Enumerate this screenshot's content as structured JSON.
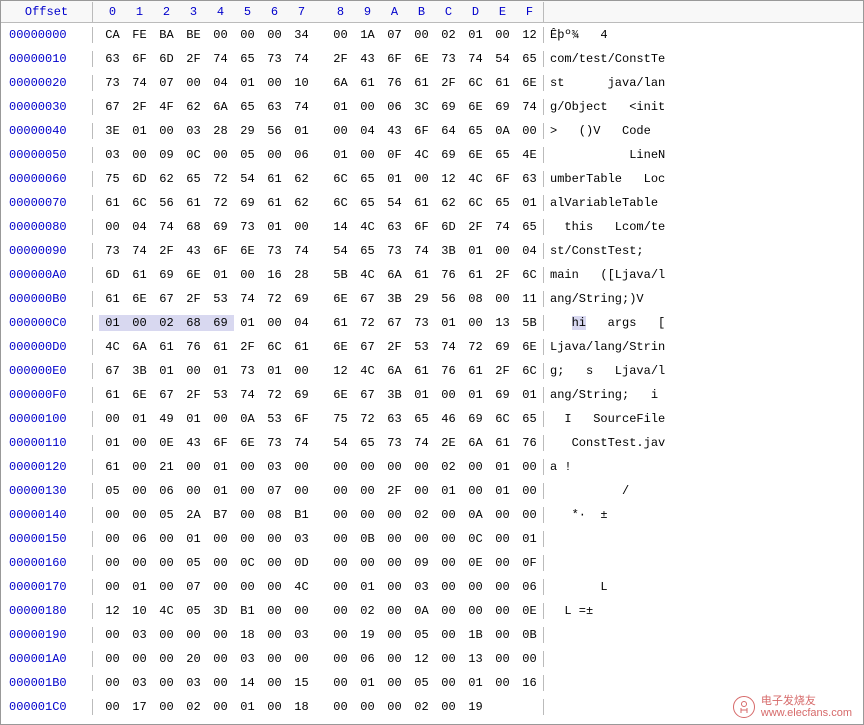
{
  "header": {
    "offset_label": "Offset",
    "columns": [
      "0",
      "1",
      "2",
      "3",
      "4",
      "5",
      "6",
      "7",
      "8",
      "9",
      "A",
      "B",
      "C",
      "D",
      "E",
      "F"
    ]
  },
  "highlight": {
    "row": 12,
    "start": 0,
    "end": 4
  },
  "ascii_highlight": {
    "row": 12,
    "text": "hi"
  },
  "rows": [
    {
      "offset": "00000000",
      "hex": [
        "CA",
        "FE",
        "BA",
        "BE",
        "00",
        "00",
        "00",
        "34",
        "00",
        "1A",
        "07",
        "00",
        "02",
        "01",
        "00",
        "12"
      ],
      "ascii": "Êþº¾   4        "
    },
    {
      "offset": "00000010",
      "hex": [
        "63",
        "6F",
        "6D",
        "2F",
        "74",
        "65",
        "73",
        "74",
        "2F",
        "43",
        "6F",
        "6E",
        "73",
        "74",
        "54",
        "65"
      ],
      "ascii": "com/test/ConstTe"
    },
    {
      "offset": "00000020",
      "hex": [
        "73",
        "74",
        "07",
        "00",
        "04",
        "01",
        "00",
        "10",
        "6A",
        "61",
        "76",
        "61",
        "2F",
        "6C",
        "61",
        "6E"
      ],
      "ascii": "st      java/lan"
    },
    {
      "offset": "00000030",
      "hex": [
        "67",
        "2F",
        "4F",
        "62",
        "6A",
        "65",
        "63",
        "74",
        "01",
        "00",
        "06",
        "3C",
        "69",
        "6E",
        "69",
        "74"
      ],
      "ascii": "g/Object   <init"
    },
    {
      "offset": "00000040",
      "hex": [
        "3E",
        "01",
        "00",
        "03",
        "28",
        "29",
        "56",
        "01",
        "00",
        "04",
        "43",
        "6F",
        "64",
        "65",
        "0A",
        "00"
      ],
      "ascii": ">   ()V   Code  "
    },
    {
      "offset": "00000050",
      "hex": [
        "03",
        "00",
        "09",
        "0C",
        "00",
        "05",
        "00",
        "06",
        "01",
        "00",
        "0F",
        "4C",
        "69",
        "6E",
        "65",
        "4E"
      ],
      "ascii": "           LineN"
    },
    {
      "offset": "00000060",
      "hex": [
        "75",
        "6D",
        "62",
        "65",
        "72",
        "54",
        "61",
        "62",
        "6C",
        "65",
        "01",
        "00",
        "12",
        "4C",
        "6F",
        "63"
      ],
      "ascii": "umberTable   Loc"
    },
    {
      "offset": "00000070",
      "hex": [
        "61",
        "6C",
        "56",
        "61",
        "72",
        "69",
        "61",
        "62",
        "6C",
        "65",
        "54",
        "61",
        "62",
        "6C",
        "65",
        "01"
      ],
      "ascii": "alVariableTable "
    },
    {
      "offset": "00000080",
      "hex": [
        "00",
        "04",
        "74",
        "68",
        "69",
        "73",
        "01",
        "00",
        "14",
        "4C",
        "63",
        "6F",
        "6D",
        "2F",
        "74",
        "65"
      ],
      "ascii": "  this   Lcom/te"
    },
    {
      "offset": "00000090",
      "hex": [
        "73",
        "74",
        "2F",
        "43",
        "6F",
        "6E",
        "73",
        "74",
        "54",
        "65",
        "73",
        "74",
        "3B",
        "01",
        "00",
        "04"
      ],
      "ascii": "st/ConstTest;   "
    },
    {
      "offset": "000000A0",
      "hex": [
        "6D",
        "61",
        "69",
        "6E",
        "01",
        "00",
        "16",
        "28",
        "5B",
        "4C",
        "6A",
        "61",
        "76",
        "61",
        "2F",
        "6C"
      ],
      "ascii": "main   ([Ljava/l"
    },
    {
      "offset": "000000B0",
      "hex": [
        "61",
        "6E",
        "67",
        "2F",
        "53",
        "74",
        "72",
        "69",
        "6E",
        "67",
        "3B",
        "29",
        "56",
        "08",
        "00",
        "11"
      ],
      "ascii": "ang/String;)V   "
    },
    {
      "offset": "000000C0",
      "hex": [
        "01",
        "00",
        "02",
        "68",
        "69",
        "01",
        "00",
        "04",
        "61",
        "72",
        "67",
        "73",
        "01",
        "00",
        "13",
        "5B"
      ],
      "ascii": "   hi   args   ["
    },
    {
      "offset": "000000D0",
      "hex": [
        "4C",
        "6A",
        "61",
        "76",
        "61",
        "2F",
        "6C",
        "61",
        "6E",
        "67",
        "2F",
        "53",
        "74",
        "72",
        "69",
        "6E"
      ],
      "ascii": "Ljava/lang/Strin"
    },
    {
      "offset": "000000E0",
      "hex": [
        "67",
        "3B",
        "01",
        "00",
        "01",
        "73",
        "01",
        "00",
        "12",
        "4C",
        "6A",
        "61",
        "76",
        "61",
        "2F",
        "6C"
      ],
      "ascii": "g;   s   Ljava/l"
    },
    {
      "offset": "000000F0",
      "hex": [
        "61",
        "6E",
        "67",
        "2F",
        "53",
        "74",
        "72",
        "69",
        "6E",
        "67",
        "3B",
        "01",
        "00",
        "01",
        "69",
        "01"
      ],
      "ascii": "ang/String;   i "
    },
    {
      "offset": "00000100",
      "hex": [
        "00",
        "01",
        "49",
        "01",
        "00",
        "0A",
        "53",
        "6F",
        "75",
        "72",
        "63",
        "65",
        "46",
        "69",
        "6C",
        "65"
      ],
      "ascii": "  I   SourceFile"
    },
    {
      "offset": "00000110",
      "hex": [
        "01",
        "00",
        "0E",
        "43",
        "6F",
        "6E",
        "73",
        "74",
        "54",
        "65",
        "73",
        "74",
        "2E",
        "6A",
        "61",
        "76"
      ],
      "ascii": "   ConstTest.jav"
    },
    {
      "offset": "00000120",
      "hex": [
        "61",
        "00",
        "21",
        "00",
        "01",
        "00",
        "03",
        "00",
        "00",
        "00",
        "00",
        "00",
        "02",
        "00",
        "01",
        "00"
      ],
      "ascii": "a !             "
    },
    {
      "offset": "00000130",
      "hex": [
        "05",
        "00",
        "06",
        "00",
        "01",
        "00",
        "07",
        "00",
        "00",
        "00",
        "2F",
        "00",
        "01",
        "00",
        "01",
        "00"
      ],
      "ascii": "          /     "
    },
    {
      "offset": "00000140",
      "hex": [
        "00",
        "00",
        "05",
        "2A",
        "B7",
        "00",
        "08",
        "B1",
        "00",
        "00",
        "00",
        "02",
        "00",
        "0A",
        "00",
        "00"
      ],
      "ascii": "   *·  ±        "
    },
    {
      "offset": "00000150",
      "hex": [
        "00",
        "06",
        "00",
        "01",
        "00",
        "00",
        "00",
        "03",
        "00",
        "0B",
        "00",
        "00",
        "00",
        "0C",
        "00",
        "01"
      ],
      "ascii": "                "
    },
    {
      "offset": "00000160",
      "hex": [
        "00",
        "00",
        "00",
        "05",
        "00",
        "0C",
        "00",
        "0D",
        "00",
        "00",
        "00",
        "09",
        "00",
        "0E",
        "00",
        "0F"
      ],
      "ascii": "                "
    },
    {
      "offset": "00000170",
      "hex": [
        "00",
        "01",
        "00",
        "07",
        "00",
        "00",
        "00",
        "4C",
        "00",
        "01",
        "00",
        "03",
        "00",
        "00",
        "00",
        "06"
      ],
      "ascii": "       L        "
    },
    {
      "offset": "00000180",
      "hex": [
        "12",
        "10",
        "4C",
        "05",
        "3D",
        "B1",
        "00",
        "00",
        "00",
        "02",
        "00",
        "0A",
        "00",
        "00",
        "00",
        "0E"
      ],
      "ascii": "  L =±          "
    },
    {
      "offset": "00000190",
      "hex": [
        "00",
        "03",
        "00",
        "00",
        "00",
        "18",
        "00",
        "03",
        "00",
        "19",
        "00",
        "05",
        "00",
        "1B",
        "00",
        "0B"
      ],
      "ascii": "                "
    },
    {
      "offset": "000001A0",
      "hex": [
        "00",
        "00",
        "00",
        "20",
        "00",
        "03",
        "00",
        "00",
        "00",
        "06",
        "00",
        "12",
        "00",
        "13",
        "00",
        "00"
      ],
      "ascii": "                "
    },
    {
      "offset": "000001B0",
      "hex": [
        "00",
        "03",
        "00",
        "03",
        "00",
        "14",
        "00",
        "15",
        "00",
        "01",
        "00",
        "05",
        "00",
        "01",
        "00",
        "16"
      ],
      "ascii": "                "
    },
    {
      "offset": "000001C0",
      "hex": [
        "00",
        "17",
        "00",
        "02",
        "00",
        "01",
        "00",
        "18",
        "00",
        "00",
        "00",
        "02",
        "00",
        "19"
      ],
      "ascii": "              "
    }
  ],
  "watermark": {
    "brand": "电子发烧友",
    "url": "www.elecfans.com"
  }
}
